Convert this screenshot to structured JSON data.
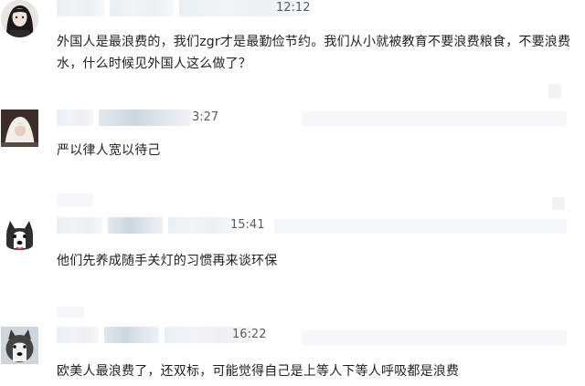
{
  "comments": [
    {
      "time": "12:12",
      "text": "外国人是最浪费的，我们zgr才是最勤俭节约。我们从小就被教育不要浪费粮食，不要浪费水，什么时候见外国人这么做了？",
      "avatar_icon": "girl-portrait-avatar-icon"
    },
    {
      "time": "3:27",
      "text": "严以律人宽以待己",
      "avatar_icon": "person-white-hood-avatar-icon"
    },
    {
      "time": "15:41",
      "text": "他们先养成随手关灯的习惯再来谈环保",
      "avatar_icon": "husky-dog-avatar-icon"
    },
    {
      "time": "16:22",
      "text": "欧美人最浪费了，还双标，可能觉得自己是上等人下等人呼吸都是浪费",
      "avatar_icon": "husky-dog-photo-avatar-icon"
    }
  ]
}
